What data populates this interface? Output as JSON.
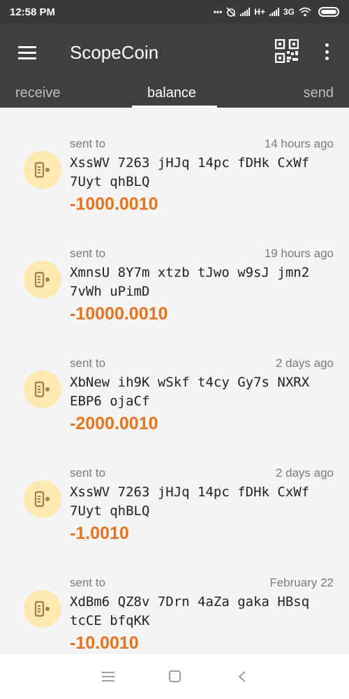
{
  "status_bar": {
    "time": "12:58 PM",
    "network_h": "H+",
    "network_3g": "3G"
  },
  "app_bar": {
    "title": "ScopeCoin",
    "menu_icon": "hamburger-menu-icon",
    "qr_icon": "qr-code-icon",
    "more_icon": "more-vert-icon"
  },
  "tabs": [
    {
      "label": "receive"
    },
    {
      "label": "balance"
    },
    {
      "label": "send"
    }
  ],
  "transactions": [
    {
      "type": "sent to",
      "time": "14 hours ago",
      "address": "XssWV 7263 jHJq 14pc fDHk CxWf 7Uyt qhBLQ",
      "amount": "-1000.0010"
    },
    {
      "type": "sent to",
      "time": "19 hours ago",
      "address": "XmnsU 8Y7m xtzb tJwo w9sJ jmn2 7vWh uPimD",
      "amount": "-10000.0010"
    },
    {
      "type": "sent to",
      "time": "2 days ago",
      "address": "XbNew ih9K wSkf t4cy Gy7s NXRX EBP6 ojaCf",
      "amount": "-2000.0010"
    },
    {
      "type": "sent to",
      "time": "2 days ago",
      "address": "XssWV 7263 jHJq 14pc fDHk CxWf 7Uyt qhBLQ",
      "amount": "-1.0010"
    },
    {
      "type": "sent to",
      "time": "February 22",
      "address": "XdBm6 QZ8v 7Drn 4aZa gaka HBsq tcCE bfqKK",
      "amount": "-10.0010"
    }
  ],
  "colors": {
    "app_bar": "#3f3f3f",
    "amount": "#e8731f",
    "avatar_bg": "#fbe9b0",
    "avatar_icon": "#a0814a"
  }
}
